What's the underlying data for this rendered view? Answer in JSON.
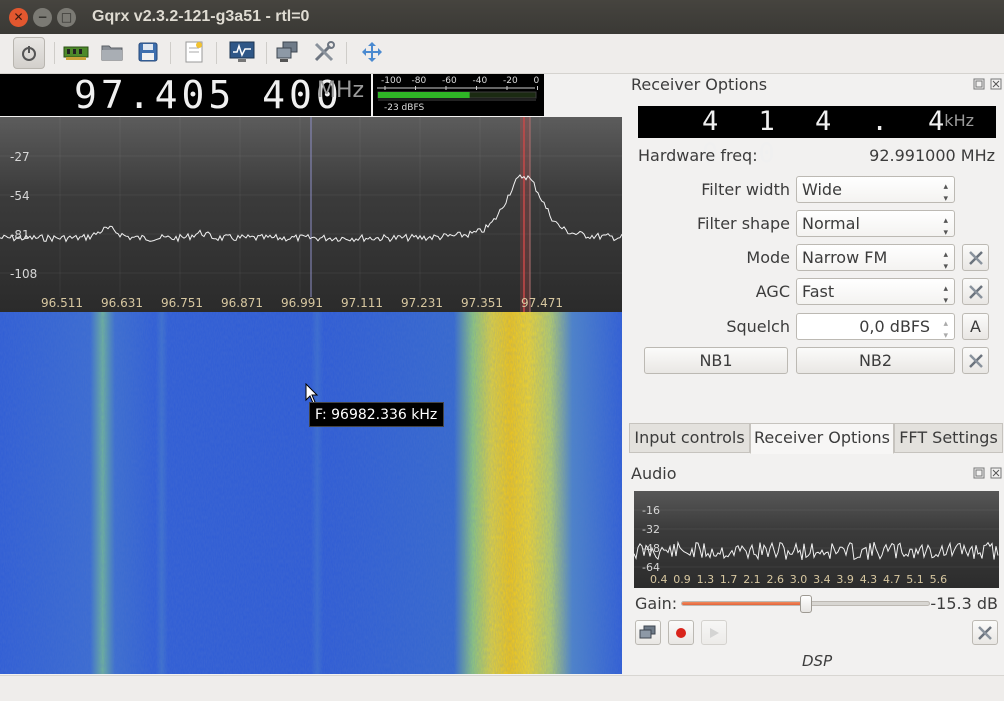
{
  "window": {
    "title": "Gqrx v2.3.2-121-g3a51 - rtl=0"
  },
  "toolbar": {
    "icons": [
      "power-icon",
      "hardware-icon",
      "open-folder-icon",
      "save-icon",
      "bookmark-icon",
      "monitor-icon",
      "network-icon",
      "tools-icon",
      "fullscreen-icon"
    ]
  },
  "frequency": {
    "value": "97.405 400",
    "unit": "MHz"
  },
  "meter": {
    "scale": [
      "-100",
      "-80",
      "-60",
      "-40",
      "-20",
      "0"
    ],
    "readout": "-23 dBFS",
    "level_fraction": 0.58
  },
  "spectrum": {
    "y_ticks": [
      "-27",
      "-54",
      "-81",
      "-108"
    ],
    "x_ticks": [
      "96.511",
      "96.631",
      "96.751",
      "96.871",
      "96.991",
      "97.111",
      "97.231",
      "97.351",
      "97.471"
    ]
  },
  "waterfall": {
    "tooltip": "F: 96982.336 kHz"
  },
  "receiver": {
    "panel_title": "Receiver Options",
    "offset_value": "4 1 4 . 4 0 0",
    "offset_unit": "kHz",
    "hw_label": "Hardware freq:",
    "hw_value": "92.991000 MHz",
    "filter_width_label": "Filter width",
    "filter_width": "Wide",
    "filter_shape_label": "Filter shape",
    "filter_shape": "Normal",
    "mode_label": "Mode",
    "mode": "Narrow FM",
    "agc_label": "AGC",
    "agc": "Fast",
    "squelch_label": "Squelch",
    "squelch": "0,0 dBFS",
    "squelch_auto": "A",
    "nb1": "NB1",
    "nb2": "NB2"
  },
  "tabs": [
    "Input controls",
    "Receiver Options",
    "FFT Settings"
  ],
  "audio": {
    "panel_title": "Audio",
    "y_ticks": [
      "-16",
      "-32",
      "-48",
      "-64"
    ],
    "x_ticks": [
      "0.4",
      "0.9",
      "1.3",
      "1.7",
      "2.1",
      "2.6",
      "3.0",
      "3.4",
      "3.9",
      "4.3",
      "4.7",
      "5.1",
      "5.6"
    ],
    "gain_label": "Gain:",
    "gain_value": "-15.3 dB",
    "gain_fraction": 0.5,
    "dsp_label": "DSP"
  },
  "colors": {
    "accent": "#e4643a",
    "record": "#d9241b",
    "waterfall_bg": "#2f5cd1",
    "signal": "#f3d20d"
  }
}
